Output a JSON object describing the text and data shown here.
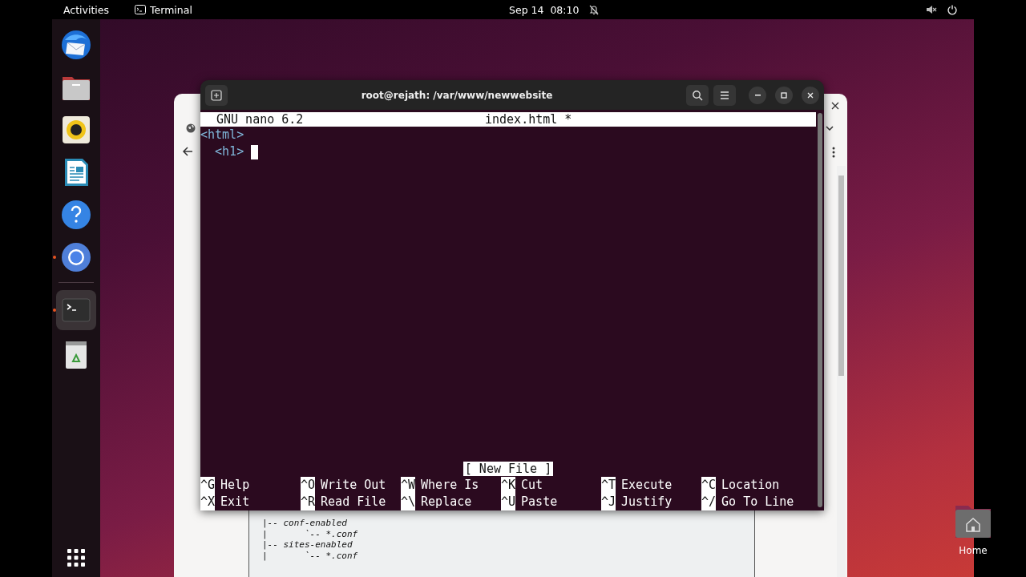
{
  "top_bar": {
    "activities": "Activities",
    "app_menu": "Terminal",
    "clock": "Sep 14  08:10"
  },
  "dock": {
    "groups": [
      [
        {
          "kind": "mail",
          "running": false,
          "selected": false
        },
        {
          "kind": "files",
          "running": false,
          "selected": false
        },
        {
          "kind": "music",
          "running": false,
          "selected": false
        },
        {
          "kind": "writer",
          "running": false,
          "selected": false
        },
        {
          "kind": "help",
          "running": false,
          "selected": false
        },
        {
          "kind": "browser",
          "running": true,
          "selected": false
        }
      ],
      [
        {
          "kind": "terminal",
          "running": true,
          "selected": true
        },
        {
          "kind": "trash",
          "running": false,
          "selected": false
        }
      ]
    ]
  },
  "browser_window": {
    "doc_lines": [
      "|-- conf-enabled",
      "|       `-- *.conf",
      "|-- sites-enabled",
      "|       `-- *.conf"
    ]
  },
  "terminal": {
    "title": "root@rejath: /var/www/newwebsite",
    "nano": {
      "version": "GNU nano 6.2",
      "filename": "index.html *",
      "lines": [
        "<html>",
        "  <h1> "
      ],
      "status": "[ New File ]",
      "shortcuts": [
        [
          {
            "key": "^G",
            "label": "Help"
          },
          {
            "key": "^O",
            "label": "Write Out"
          },
          {
            "key": "^W",
            "label": "Where Is"
          },
          {
            "key": "^K",
            "label": "Cut"
          },
          {
            "key": "^T",
            "label": "Execute"
          },
          {
            "key": "^C",
            "label": "Location"
          }
        ],
        [
          {
            "key": "^X",
            "label": "Exit"
          },
          {
            "key": "^R",
            "label": "Read File"
          },
          {
            "key": "^\\",
            "label": "Replace"
          },
          {
            "key": "^U",
            "label": "Paste"
          },
          {
            "key": "^J",
            "label": "Justify"
          },
          {
            "key": "^/",
            "label": "Go To Line"
          }
        ]
      ]
    }
  },
  "desktop_icons": [
    {
      "label": "Home"
    }
  ]
}
